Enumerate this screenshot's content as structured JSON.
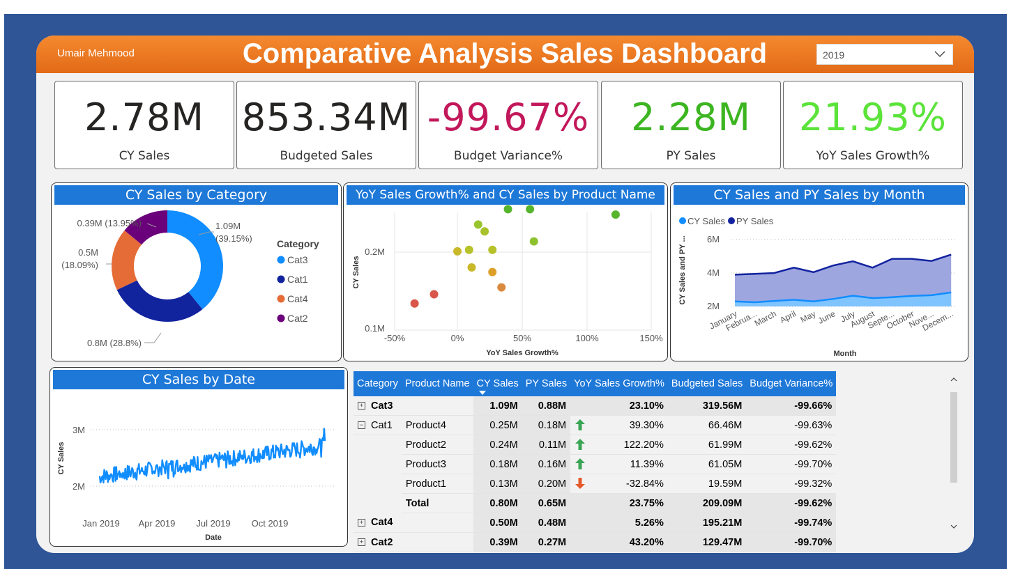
{
  "author": "Umair Mehmood",
  "title": "Comparative Analysis Sales Dashboard",
  "year_filter": {
    "value": "2019"
  },
  "kpis": [
    {
      "value": "2.78M",
      "label": "CY Sales",
      "color": "#252423"
    },
    {
      "value": "853.34M",
      "label": "Budgeted Sales",
      "color": "#252423"
    },
    {
      "value": "-99.67%",
      "label": "Budget Variance%",
      "color": "#c2185b"
    },
    {
      "value": "2.28M",
      "label": "PY Sales",
      "color": "#3cb521"
    },
    {
      "value": "21.93%",
      "label": "YoY Sales Growth%",
      "color": "#5be33a"
    }
  ],
  "donut": {
    "title": "CY Sales by Category",
    "legend_title": "Category",
    "slices": [
      {
        "name": "Cat3",
        "value": 1.09,
        "pct": 39.15,
        "label1": "1.09M",
        "label2": "(39.15%)",
        "color": "#118dff"
      },
      {
        "name": "Cat1",
        "value": 0.8,
        "pct": 28.8,
        "label1": "0.8M (28.8%)",
        "label2": "",
        "color": "#12239e"
      },
      {
        "name": "Cat4",
        "value": 0.5,
        "pct": 18.09,
        "label1": "0.5M",
        "label2": "(18.09%)",
        "color": "#e66c37"
      },
      {
        "name": "Cat2",
        "value": 0.39,
        "pct": 13.95,
        "label1": "0.39M (13.95%)",
        "label2": "",
        "color": "#6b007b"
      }
    ]
  },
  "scatter": {
    "title": "YoY Sales Growth% and CY Sales by Product Name",
    "xlabel": "YoY Sales Growth%",
    "ylabel": "CY Sales",
    "xticks": [
      "-50%",
      "0%",
      "50%",
      "100%",
      "150%"
    ],
    "yticks": [
      "0.1M",
      "0.2M"
    ]
  },
  "monthly": {
    "title": "CY Sales and PY Sales by Month",
    "legend": [
      "CY Sales",
      "PY Sales"
    ],
    "xlabel": "Month",
    "ylabel": "CY Sales and PY ...",
    "yticks": [
      "2M",
      "4M",
      "6M"
    ],
    "months": [
      "January",
      "Februa...",
      "March",
      "April",
      "May",
      "June",
      "July",
      "August",
      "Septe...",
      "October",
      "Nove...",
      "Decem..."
    ]
  },
  "daily": {
    "title": "CY Sales by Date",
    "xlabel": "Date",
    "ylabel": "CY Sales",
    "yticks": [
      "2M",
      "3M"
    ],
    "xticks": [
      "Jan 2019",
      "Apr 2019",
      "Jul 2019",
      "Oct 2019"
    ]
  },
  "table": {
    "headers": [
      "Category",
      "Product Name",
      "CY Sales",
      "PY Sales",
      "YoY Sales Growth%",
      "Budgeted Sales",
      "Budget Variance%"
    ],
    "rows": [
      {
        "type": "cat",
        "expand": "+",
        "category": "Cat3",
        "product": "",
        "cy": "1.09M",
        "py": "0.88M",
        "arrow": "",
        "yoy": "23.10%",
        "budget": "319.56M",
        "variance": "-99.66%"
      },
      {
        "type": "cat-open",
        "expand": "−",
        "category": "Cat1",
        "product": "Product4",
        "cy": "0.25M",
        "py": "0.18M",
        "arrow": "up",
        "yoy": "39.30%",
        "budget": "66.46M",
        "variance": "-99.63%"
      },
      {
        "type": "prod",
        "expand": "",
        "category": "",
        "product": "Product2",
        "cy": "0.24M",
        "py": "0.11M",
        "arrow": "up",
        "yoy": "122.20%",
        "budget": "61.99M",
        "variance": "-99.62%"
      },
      {
        "type": "prod",
        "expand": "",
        "category": "",
        "product": "Product3",
        "cy": "0.18M",
        "py": "0.16M",
        "arrow": "up",
        "yoy": "11.39%",
        "budget": "61.05M",
        "variance": "-99.70%"
      },
      {
        "type": "prod",
        "expand": "",
        "category": "",
        "product": "Product1",
        "cy": "0.13M",
        "py": "0.20M",
        "arrow": "down",
        "yoy": "-32.84%",
        "budget": "19.59M",
        "variance": "-99.32%"
      },
      {
        "type": "total",
        "expand": "",
        "category": "",
        "product": "Total",
        "cy": "0.80M",
        "py": "0.65M",
        "arrow": "",
        "yoy": "23.75%",
        "budget": "209.09M",
        "variance": "-99.62%"
      },
      {
        "type": "cat",
        "expand": "+",
        "category": "Cat4",
        "product": "",
        "cy": "0.50M",
        "py": "0.48M",
        "arrow": "",
        "yoy": "5.26%",
        "budget": "195.21M",
        "variance": "-99.74%"
      },
      {
        "type": "cat",
        "expand": "+",
        "category": "Cat2",
        "product": "",
        "cy": "0.39M",
        "py": "0.27M",
        "arrow": "",
        "yoy": "43.20%",
        "budget": "129.47M",
        "variance": "-99.70%"
      }
    ]
  }
}
